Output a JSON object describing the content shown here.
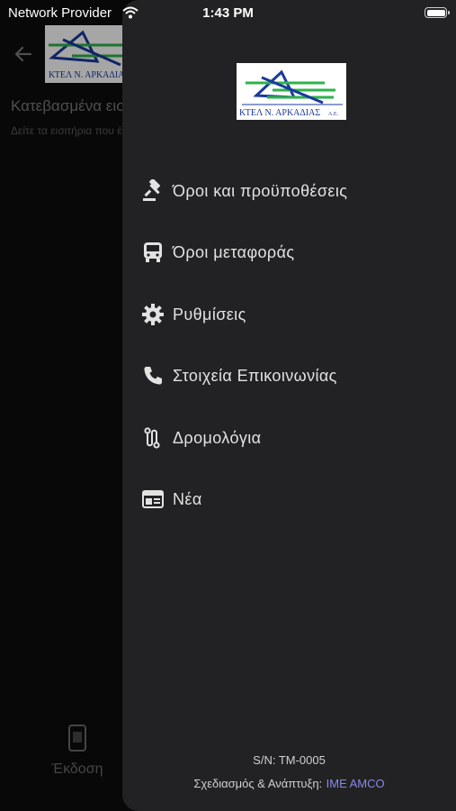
{
  "status_bar": {
    "carrier": "Network Provider",
    "time": "1:43 PM"
  },
  "background_screen": {
    "title": "Κατεβασμένα εισιτήρια",
    "subtitle": "Δείτε τα εισιτήρια που έχετε κατεβάσει",
    "bottom_nav_label": "Έκδοση",
    "logo_text": "ΚΤΕΛ Ν. ΑΡΚΑΔΙΑΣ"
  },
  "drawer": {
    "logo_text": "ΚΤΕΛ Ν. ΑΡΚΑΔΙΑΣ",
    "logo_suffix": "Α.Ε.",
    "menu": [
      {
        "label": "Όροι και προϋποθέσεις",
        "icon": "gavel-icon"
      },
      {
        "label": "Όροι μεταφοράς",
        "icon": "bus-icon"
      },
      {
        "label": "Ρυθμίσεις",
        "icon": "gear-icon"
      },
      {
        "label": "Στοιχεία Επικοινωνίας",
        "icon": "phone-icon"
      },
      {
        "label": "Δρομολόγια",
        "icon": "route-icon"
      },
      {
        "label": "Νέα",
        "icon": "news-icon"
      }
    ],
    "footer": {
      "serial": "S/N: TM-0005",
      "design_label": "Σχεδιασμός & Ανάπτυξη:",
      "company": "IME AMCO"
    }
  },
  "colors": {
    "drawer_bg": "#222224",
    "link_accent": "#8a88e8",
    "logo_blue": "#1a3a9c",
    "logo_green": "#2db34a"
  }
}
